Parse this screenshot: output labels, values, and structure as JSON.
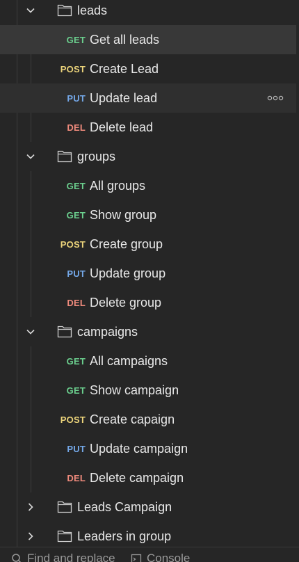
{
  "colors": {
    "background": "#262626",
    "selected_row": "#383838",
    "get": "#6bcf8e",
    "post": "#ecd47b",
    "put": "#74a8e8",
    "del": "#ef8a7c"
  },
  "tree": [
    {
      "type": "folder",
      "name": "leads",
      "expanded": true,
      "chevron_icon": "chevron-down-icon"
    },
    {
      "type": "request",
      "method": "GET",
      "name": "Get all leads",
      "selected": true
    },
    {
      "type": "request",
      "method": "POST",
      "name": "Create Lead"
    },
    {
      "type": "request",
      "method": "PUT",
      "name": "Update lead",
      "hover": true,
      "more_icon": "more-options-icon"
    },
    {
      "type": "request",
      "method": "DEL",
      "name": "Delete lead"
    },
    {
      "type": "folder",
      "name": "groups",
      "expanded": true,
      "chevron_icon": "chevron-down-icon"
    },
    {
      "type": "request",
      "method": "GET",
      "name": "All groups"
    },
    {
      "type": "request",
      "method": "GET",
      "name": "Show group"
    },
    {
      "type": "request",
      "method": "POST",
      "name": "Create group"
    },
    {
      "type": "request",
      "method": "PUT",
      "name": "Update group"
    },
    {
      "type": "request",
      "method": "DEL",
      "name": "Delete group"
    },
    {
      "type": "folder",
      "name": "campaigns",
      "expanded": true,
      "chevron_icon": "chevron-down-icon"
    },
    {
      "type": "request",
      "method": "GET",
      "name": "All campaigns"
    },
    {
      "type": "request",
      "method": "GET",
      "name": "Show campaign"
    },
    {
      "type": "request",
      "method": "POST",
      "name": "Create capaign"
    },
    {
      "type": "request",
      "method": "PUT",
      "name": "Update campaign"
    },
    {
      "type": "request",
      "method": "DEL",
      "name": "Delete campaign"
    },
    {
      "type": "folder",
      "name": "Leads Campaign",
      "expanded": false,
      "chevron_icon": "chevron-right-icon"
    },
    {
      "type": "folder",
      "name": "Leaders in group",
      "expanded": false,
      "chevron_icon": "chevron-right-icon"
    }
  ],
  "footer": {
    "find_replace_label": "Find and replace",
    "find_replace_icon": "search-icon",
    "console_label": "Console",
    "console_icon": "console-icon"
  }
}
